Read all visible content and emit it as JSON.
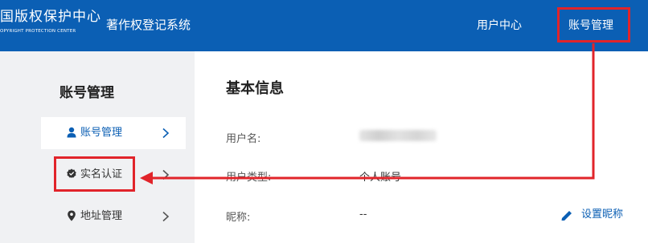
{
  "header": {
    "logo_cn": "国版权保护中心",
    "logo_en": "OPYRIGHT PROTECTION CENTER",
    "system_title": "著作权登记系统",
    "nav": {
      "user_center": "用户中心",
      "account_management": "账号管理"
    }
  },
  "sidebar": {
    "title": "账号管理",
    "items": [
      {
        "label": "账号管理",
        "icon": "user-icon",
        "active": true
      },
      {
        "label": "实名认证",
        "icon": "verified-badge-icon",
        "active": false
      },
      {
        "label": "地址管理",
        "icon": "location-pin-icon",
        "active": false
      }
    ]
  },
  "main": {
    "section_title": "基本信息",
    "fields": [
      {
        "label": "用户名:",
        "value": ""
      },
      {
        "label": "用户类型:",
        "value": "个人账号"
      },
      {
        "label": "昵称:",
        "value": "--"
      }
    ],
    "edit_nickname_label": "设置昵称"
  },
  "colors": {
    "header_bg": "#0b5fb4",
    "accent": "#0b5fb4",
    "annotation": "#e1242a",
    "sidebar_bg": "#f0f1f3"
  }
}
